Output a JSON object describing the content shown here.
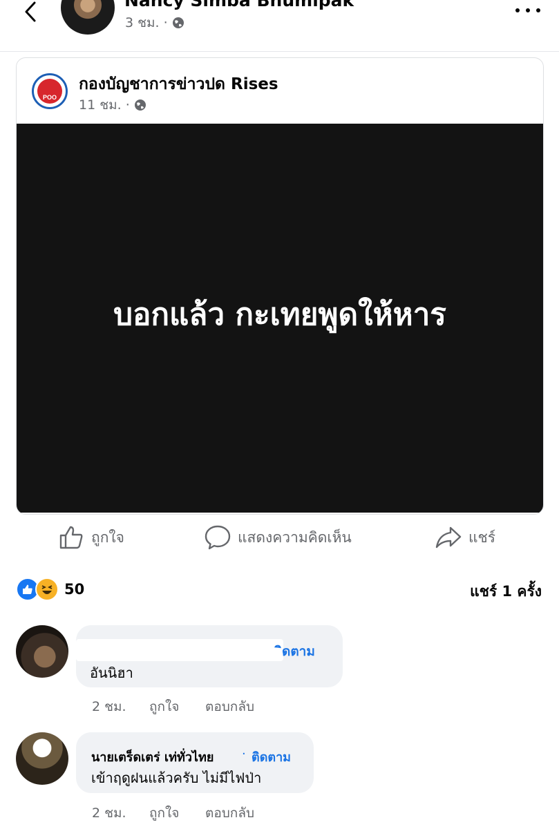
{
  "header": {
    "author_name": "Nancy Simba Bhumipak",
    "time": "3 ชม.",
    "separator": "·"
  },
  "shared_post": {
    "page_name": "กองบัญชาการข่าวปด Rises",
    "time": "11 ชม.",
    "separator": "·",
    "avatar_label": "POO",
    "image_text": "บอกแล้ว กะเทยพูดให้หาร"
  },
  "actions": {
    "like": "ถูกใจ",
    "comment": "แสดงความคิดเห็น",
    "share": "แชร์"
  },
  "stats": {
    "reaction_count": "50",
    "share_count": "แชร์ 1 ครั้ง"
  },
  "comments": [
    {
      "follow_label": "ิดตาม",
      "text": "อันนิฮา",
      "time": "2 ชม.",
      "like_label": "ถูกใจ",
      "reply_label": "ตอบกลับ"
    },
    {
      "name": "นายเตร็ดเตร่ เท่ทั่วไทย",
      "separator": "·",
      "follow_label": "ติดตาม",
      "text": "เข้าฤดูฝนแล้วครับ ไม่มีไฟป่า",
      "time": "2 ชม.",
      "like_label": "ถูกใจ",
      "reply_label": "ตอบกลับ"
    }
  ],
  "colors": {
    "accent": "#1877f2",
    "link": "#1b74e4",
    "secondary_text": "#65676b",
    "bubble": "#f0f2f5",
    "image_background": "#131313"
  },
  "icons": [
    "back-arrow-icon",
    "globe-icon",
    "more-dots-icon",
    "thumbs-up-icon",
    "comment-bubble-icon",
    "share-arrow-icon",
    "like-reaction-icon",
    "haha-reaction-icon"
  ]
}
